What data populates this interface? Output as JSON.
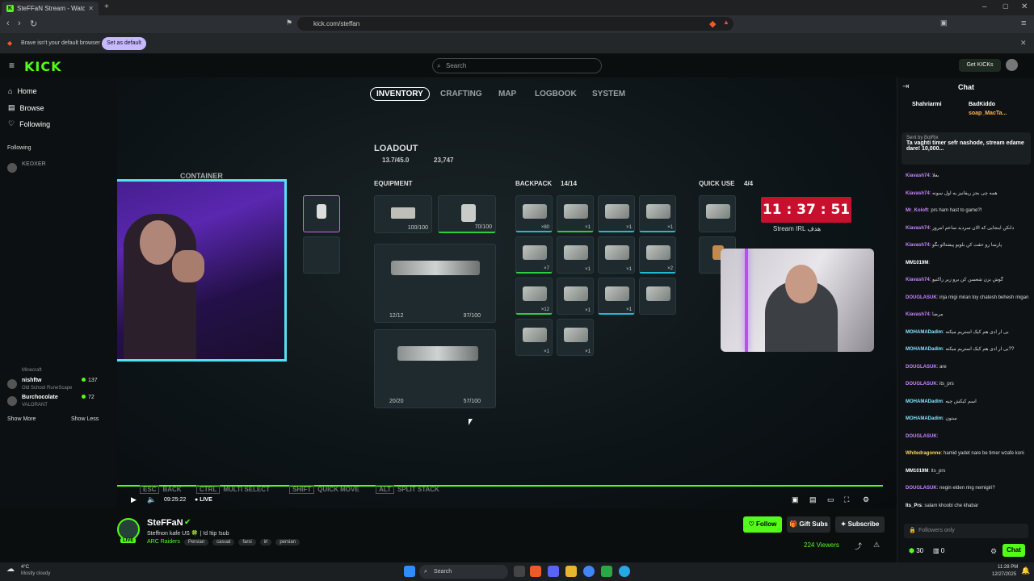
{
  "browser": {
    "tab_title": "SteFFaN Stream - Watch Live on",
    "url": "kick.com/steffan",
    "info_text": "Brave isn't your default browser",
    "set_default": "Set as default"
  },
  "header": {
    "logo": "KICK",
    "search_placeholder": "Search",
    "get_kicks": "Get KICKs"
  },
  "sidebar": {
    "nav": [
      "Home",
      "Browse",
      "Following"
    ],
    "following_label": "Following",
    "channels": [
      {
        "name": "KEOXER",
        "game": "",
        "viewers": ""
      },
      {
        "name": "nishftw",
        "game": "Old School RuneScape",
        "viewers": "137"
      },
      {
        "name": "Burchocolate",
        "game": "VALORANT",
        "viewers": "72"
      }
    ],
    "partial_channel_game": "Minecraft",
    "show_more": "Show More",
    "show_less": "Show Less"
  },
  "game": {
    "tabs": [
      "INVENTORY",
      "CRAFTING",
      "MAP",
      "LOGBOOK",
      "SYSTEM"
    ],
    "loadout_title": "LOADOUT",
    "loadout_weight": "13.7/45.0",
    "loadout_value": "23,747",
    "container_label": "CONTAINER",
    "equipment_label": "EQUIPMENT",
    "backpack_label": "BACKPACK",
    "backpack_count": "14/14",
    "quickuse_label": "QUICK USE",
    "quickuse_count": "4/4",
    "equip_slot1": "100/100",
    "equip_slot2": "70/100",
    "gun1_ammo": "12/12",
    "gun1_dur": "97/100",
    "gun2_ammo": "20/20",
    "gun2_dur": "57/100",
    "backpack_counts": [
      "×80",
      "×1",
      "×1",
      "×1",
      "×7",
      "×1",
      "×1",
      "×2",
      "×12",
      "×1",
      "×1",
      "",
      "×1",
      "×1"
    ],
    "hints": [
      {
        "key": "ESC",
        "label": "BACK"
      },
      {
        "key": "CTRL",
        "label": "MULTI SELECT"
      },
      {
        "key": "SHIFT",
        "label": "QUICK MOVE"
      },
      {
        "key": "ALT",
        "label": "SPLIT STACK"
      }
    ],
    "timer": "11 : 37 : 51",
    "stream_irl": "Stream IRL هدف"
  },
  "player": {
    "time": "09:25:22",
    "live": "LIVE"
  },
  "channel": {
    "live_badge": "LIVE",
    "name": "SteFFaN",
    "title": "Steffnon kafe US 🍀 | !d !tip !sub",
    "game": "ARC Raiders",
    "tags": [
      "Persian",
      "casual",
      "farsi",
      "irl",
      "persian"
    ],
    "follow": "Follow",
    "gift_subs": "Gift Subs",
    "subscribe": "Subscribe",
    "viewers": "224 Viewers"
  },
  "chat": {
    "title": "Chat",
    "top1": "Shahriarmi",
    "top2": "BadKiddo",
    "top3": "soap_MacTa...",
    "pinned_sender": "Sent by BotRix",
    "pinned_text": "Ta vaghti timer sefr nashode, stream edame dare! 10,000...",
    "messages": [
      {
        "user": "Kiavash74",
        "text": "بغلا",
        "color": "#c785ff"
      },
      {
        "user": "Kiavash74",
        "text": "همه چی بجز ریفانیز یه اول سونه",
        "color": "#c785ff"
      },
      {
        "user": "Mr_Koloft",
        "text": "prs ham hast to game?!",
        "color": "#c785ff"
      },
      {
        "user": "Kiavash74",
        "text": "دانکن اینجایی که الان سردید ساعم امروز",
        "color": "#c785ff"
      },
      {
        "user": "Kiavash74",
        "text": "پارسا رو حقت کن بلویو پیشتالو بگو",
        "color": "#c785ff"
      },
      {
        "user": "MM1019M",
        "text": "",
        "color": "#ffffff"
      },
      {
        "user": "Kiavash74",
        "text": "گوش بزن شعسن کن برو زیر راکتیو",
        "color": "#c785ff"
      },
      {
        "user": "DOUGLASUK",
        "text": "inja migi miran toy chatesh behesh migan",
        "color": "#c785ff"
      },
      {
        "user": "Kiavash74",
        "text": "مرضا",
        "color": "#c785ff"
      },
      {
        "user": "MOHAMADadim",
        "text": "بی ار ادی هم کیک استریم میکنه",
        "color": "#7ee3ff"
      },
      {
        "user": "MOHAMADadim",
        "text": "بی ار ادی هم کیک استریم میکنه??",
        "color": "#7ee3ff"
      },
      {
        "user": "DOUGLASUK",
        "text": "are",
        "color": "#c785ff"
      },
      {
        "user": "DOUGLASUK",
        "text": "its_prs",
        "color": "#c785ff"
      },
      {
        "user": "MOHAMADadim",
        "text": "اسم کیکش چیه",
        "color": "#7ee3ff"
      },
      {
        "user": "MOHAMADadim",
        "text": "ستون",
        "color": "#7ee3ff"
      },
      {
        "user": "DOUGLASUK",
        "text": "",
        "color": "#c785ff"
      },
      {
        "user": "Whitedragonne",
        "text": "hamid yadet nare be timer wzafe koni",
        "color": "#ffd85c"
      },
      {
        "user": "MM1019M",
        "text": "its_prs",
        "color": "#ffffff"
      },
      {
        "user": "DOUGLASUK",
        "text": "negin elden ring nemigiri?",
        "color": "#c785ff"
      },
      {
        "user": "Its_Prs",
        "text": "salam khoobi che khabar",
        "color": "#ffffff"
      }
    ],
    "input_placeholder": "Followers only",
    "points": "30",
    "gifts": "0",
    "chat_button": "Chat"
  },
  "taskbar": {
    "weather_temp": "4°C",
    "weather_desc": "Mostly cloudy",
    "search": "Search",
    "time": "11:28 PM",
    "date": "12/27/2025"
  }
}
